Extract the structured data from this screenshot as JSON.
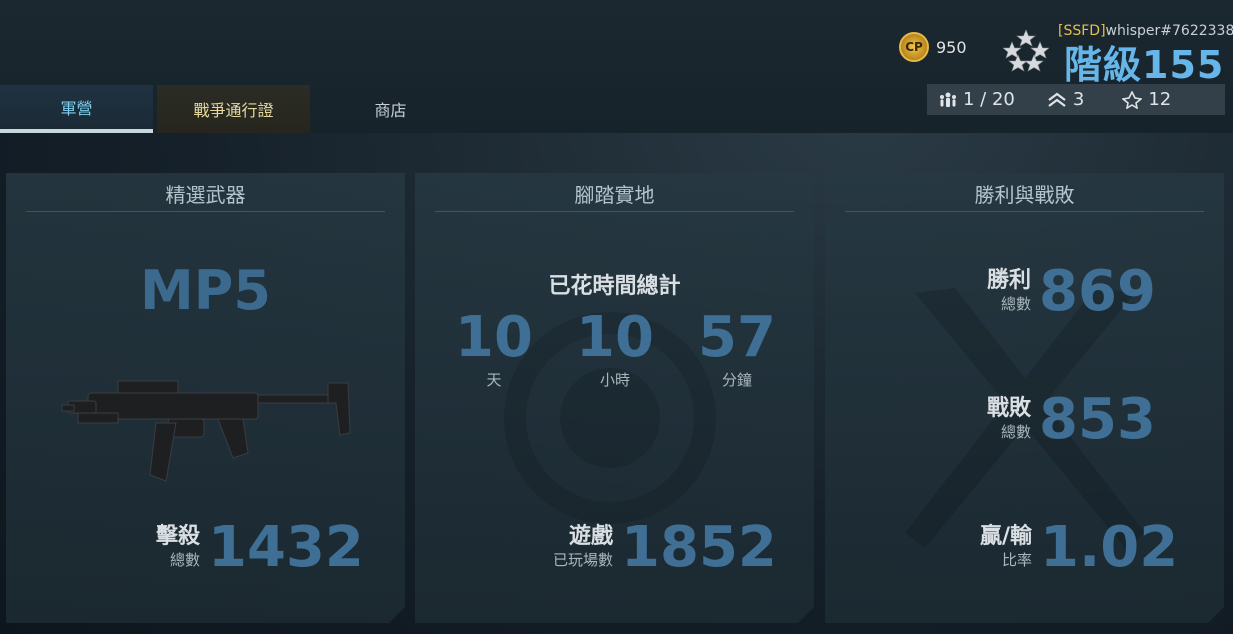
{
  "header": {
    "tabs": [
      {
        "label": "軍營"
      },
      {
        "label": "戰爭通行證"
      },
      {
        "label": "商店"
      }
    ],
    "cp": {
      "icon": "cp-coin-icon",
      "icon_text": "CP",
      "value": "950"
    },
    "user": {
      "tag": "[SSFD]",
      "name": "whisper#7622338",
      "rank": "階級155"
    },
    "stats": [
      {
        "icon": "squad-icon",
        "value": "1 / 20"
      },
      {
        "icon": "prestige-icon",
        "value": "3"
      },
      {
        "icon": "rank-badge-icon",
        "value": "12"
      }
    ]
  },
  "cards": {
    "weapon": {
      "title": "精選武器",
      "name": "MP5",
      "stat_label": "擊殺",
      "stat_sub": "總數",
      "stat_value": "1432"
    },
    "boots": {
      "title": "腳踏實地",
      "time_label": "已花時間總計",
      "days": "10",
      "days_unit": "天",
      "hours": "10",
      "hours_unit": "小時",
      "minutes": "57",
      "minutes_unit": "分鐘",
      "stat_label": "遊戲",
      "stat_sub": "已玩場數",
      "stat_value": "1852"
    },
    "wins": {
      "title": "勝利與戰敗",
      "wins_label": "勝利",
      "wins_sub": "總數",
      "wins_value": "869",
      "losses_label": "戰敗",
      "losses_sub": "總數",
      "losses_value": "853",
      "ratio_label": "贏/輸",
      "ratio_sub": "比率",
      "ratio_value": "1.02"
    }
  },
  "colors": {
    "accent_blue": "#66b6ea",
    "stat_blue": "#3f6f94",
    "gold": "#e5c04a"
  }
}
